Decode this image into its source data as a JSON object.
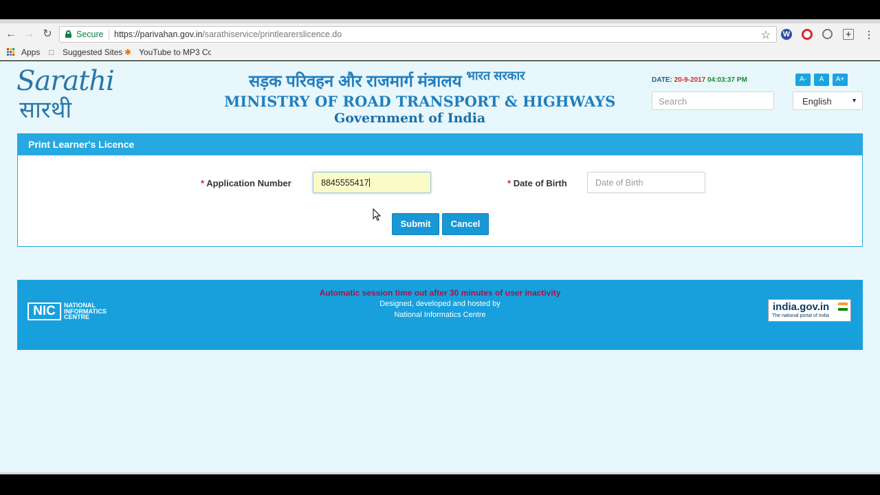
{
  "browser": {
    "secure_label": "Secure",
    "url_host": "https://parivahan.gov.in",
    "url_path": "/sarathiservice/printlearerslicence.do",
    "bookmarks": [
      "Apps",
      "Suggested Sites",
      "YouTube to MP3 Co"
    ]
  },
  "header": {
    "logo_en": "Sarathi",
    "logo_hi": "सारथी",
    "ministry_hindi": "सड़क परिवहन और राजमार्ग मंत्रालय",
    "bharat_sarkar": "भारत सरकार",
    "ministry_english": "MINISTRY OF ROAD TRANSPORT & HIGHWAYS",
    "government": "Government of India",
    "date_label": "DATE:",
    "date_value": "20-9-2017",
    "time_value": "04:03:37 PM",
    "font_buttons": [
      "A-",
      "A",
      "A+"
    ],
    "search_placeholder": "Search",
    "language": "English"
  },
  "form": {
    "title": "Print Learner's Licence",
    "required_mark": "*",
    "app_number_label": "Application Number",
    "app_number_value": "8845555417",
    "dob_label": "Date of Birth",
    "dob_placeholder": "Date of Birth",
    "submit_label": "Submit",
    "cancel_label": "Cancel"
  },
  "footer": {
    "nic_abbr": "NIC",
    "nic_line1": "NATIONAL",
    "nic_line2": "INFORMATICS",
    "nic_line3": "CENTRE",
    "timeout_notice": "Automatic session time out after 30 minutes of user inactivity",
    "designed_by": "Designed, developed and hosted by",
    "centre": "National Informatics Centre",
    "portal_name": "india.gov.in",
    "portal_tagline": "The national portal of India"
  },
  "colors": {
    "accent": "#26a8e0",
    "footer_bg": "#18a0dc",
    "page_bg": "#e8f7fc",
    "required": "#d9261c"
  }
}
